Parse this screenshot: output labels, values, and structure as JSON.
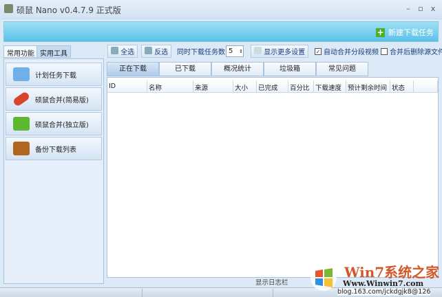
{
  "window": {
    "title": "硕鼠 Nano v0.4.7.9 正式版",
    "minimize": "–",
    "maximize": "▫",
    "close": "x"
  },
  "banner": {
    "new_task": "新建下载任务",
    "plus": "+"
  },
  "left_tabs": [
    {
      "label": "常用功能"
    },
    {
      "label": "实用工具"
    }
  ],
  "left_items": [
    {
      "label": "计划任务下载",
      "icon": "calendar-icon",
      "color": "#6fb0e8"
    },
    {
      "label": "硕鼠合并(简易版)",
      "icon": "pill-icon",
      "color": "#d9442a"
    },
    {
      "label": "硕鼠合并(独立版)",
      "icon": "puzzle-icon",
      "color": "#5cb82e"
    },
    {
      "label": "备份下载列表",
      "icon": "wallet-icon",
      "color": "#b0661e"
    }
  ],
  "toolbar": {
    "select_all": "全选",
    "invert": "反选",
    "concurrent_label": "同时下载任务数:",
    "concurrent_value": "5",
    "more_settings": "显示更多设置",
    "auto_merge": "自动合并分段视频",
    "auto_merge_checked": true,
    "delete_after_merge": "合并后删除源文件",
    "delete_after_merge_checked": false
  },
  "main_tabs": [
    {
      "label": "正在下载"
    },
    {
      "label": "已下载"
    },
    {
      "label": "概况统计"
    },
    {
      "label": "垃圾箱"
    },
    {
      "label": "常见问题"
    }
  ],
  "columns": [
    "ID",
    "名称",
    "来源",
    "大小",
    "已完成",
    "百分比",
    "下载速度",
    "预计剩余时间",
    "状态",
    ""
  ],
  "log_toggle": "显示日志栏",
  "watermark": {
    "title": "Win7系统之家",
    "url": "Www.Winwin7.com",
    "blog": "blog.163.com/jckdgjk8@126"
  }
}
